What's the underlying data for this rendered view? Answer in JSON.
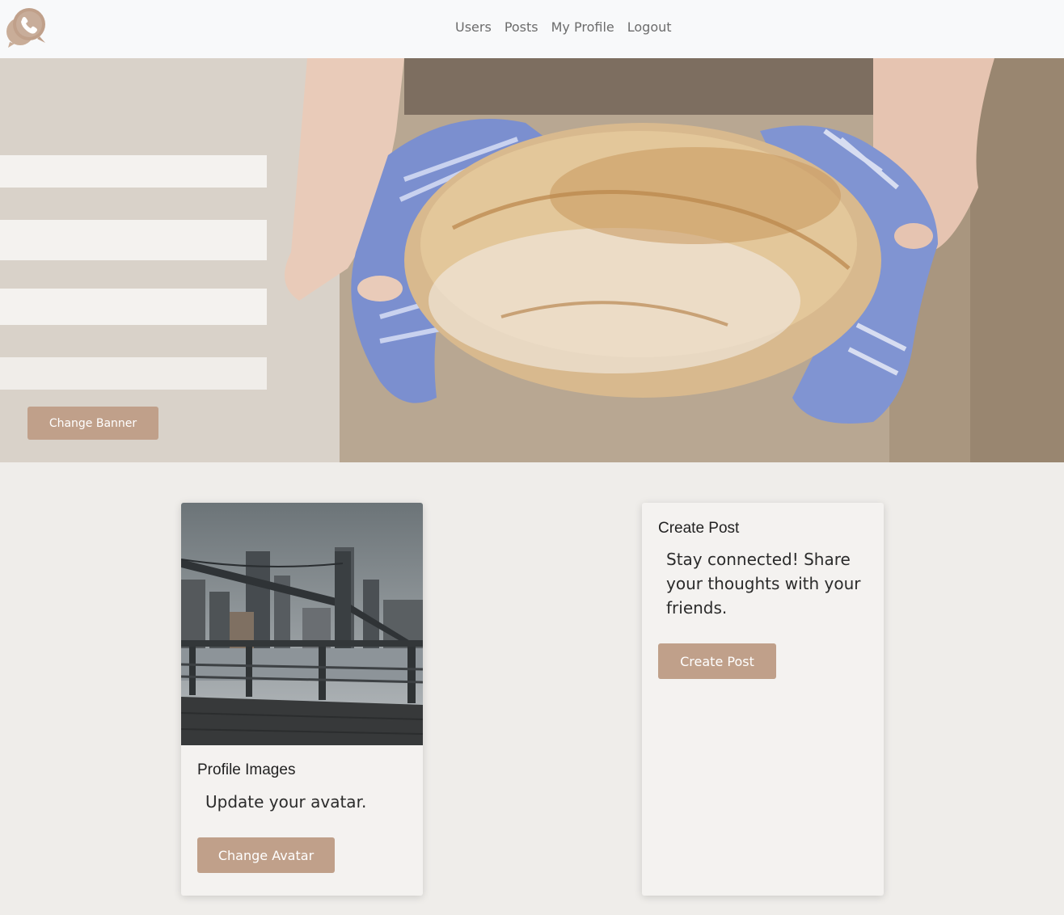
{
  "navbar": {
    "logo_icon": "phone-chat-icon",
    "links": [
      {
        "label": "Users"
      },
      {
        "label": "Posts"
      },
      {
        "label": "My Profile"
      },
      {
        "label": "Logout"
      }
    ]
  },
  "banner": {
    "image": "bread-loaf-photo",
    "change_banner_label": "Change Banner"
  },
  "profile_card": {
    "image": "bridge-city-photo",
    "title": "Profile Images",
    "text": "Update your avatar.",
    "button_label": "Change Avatar"
  },
  "post_card": {
    "title": "Create Post",
    "text": "Stay connected! Share your thoughts with your friends.",
    "button_label": "Create Post"
  },
  "colors": {
    "accent": "#c0a08a",
    "navbar_bg": "#f8f9fa",
    "page_bg": "#efedea"
  }
}
